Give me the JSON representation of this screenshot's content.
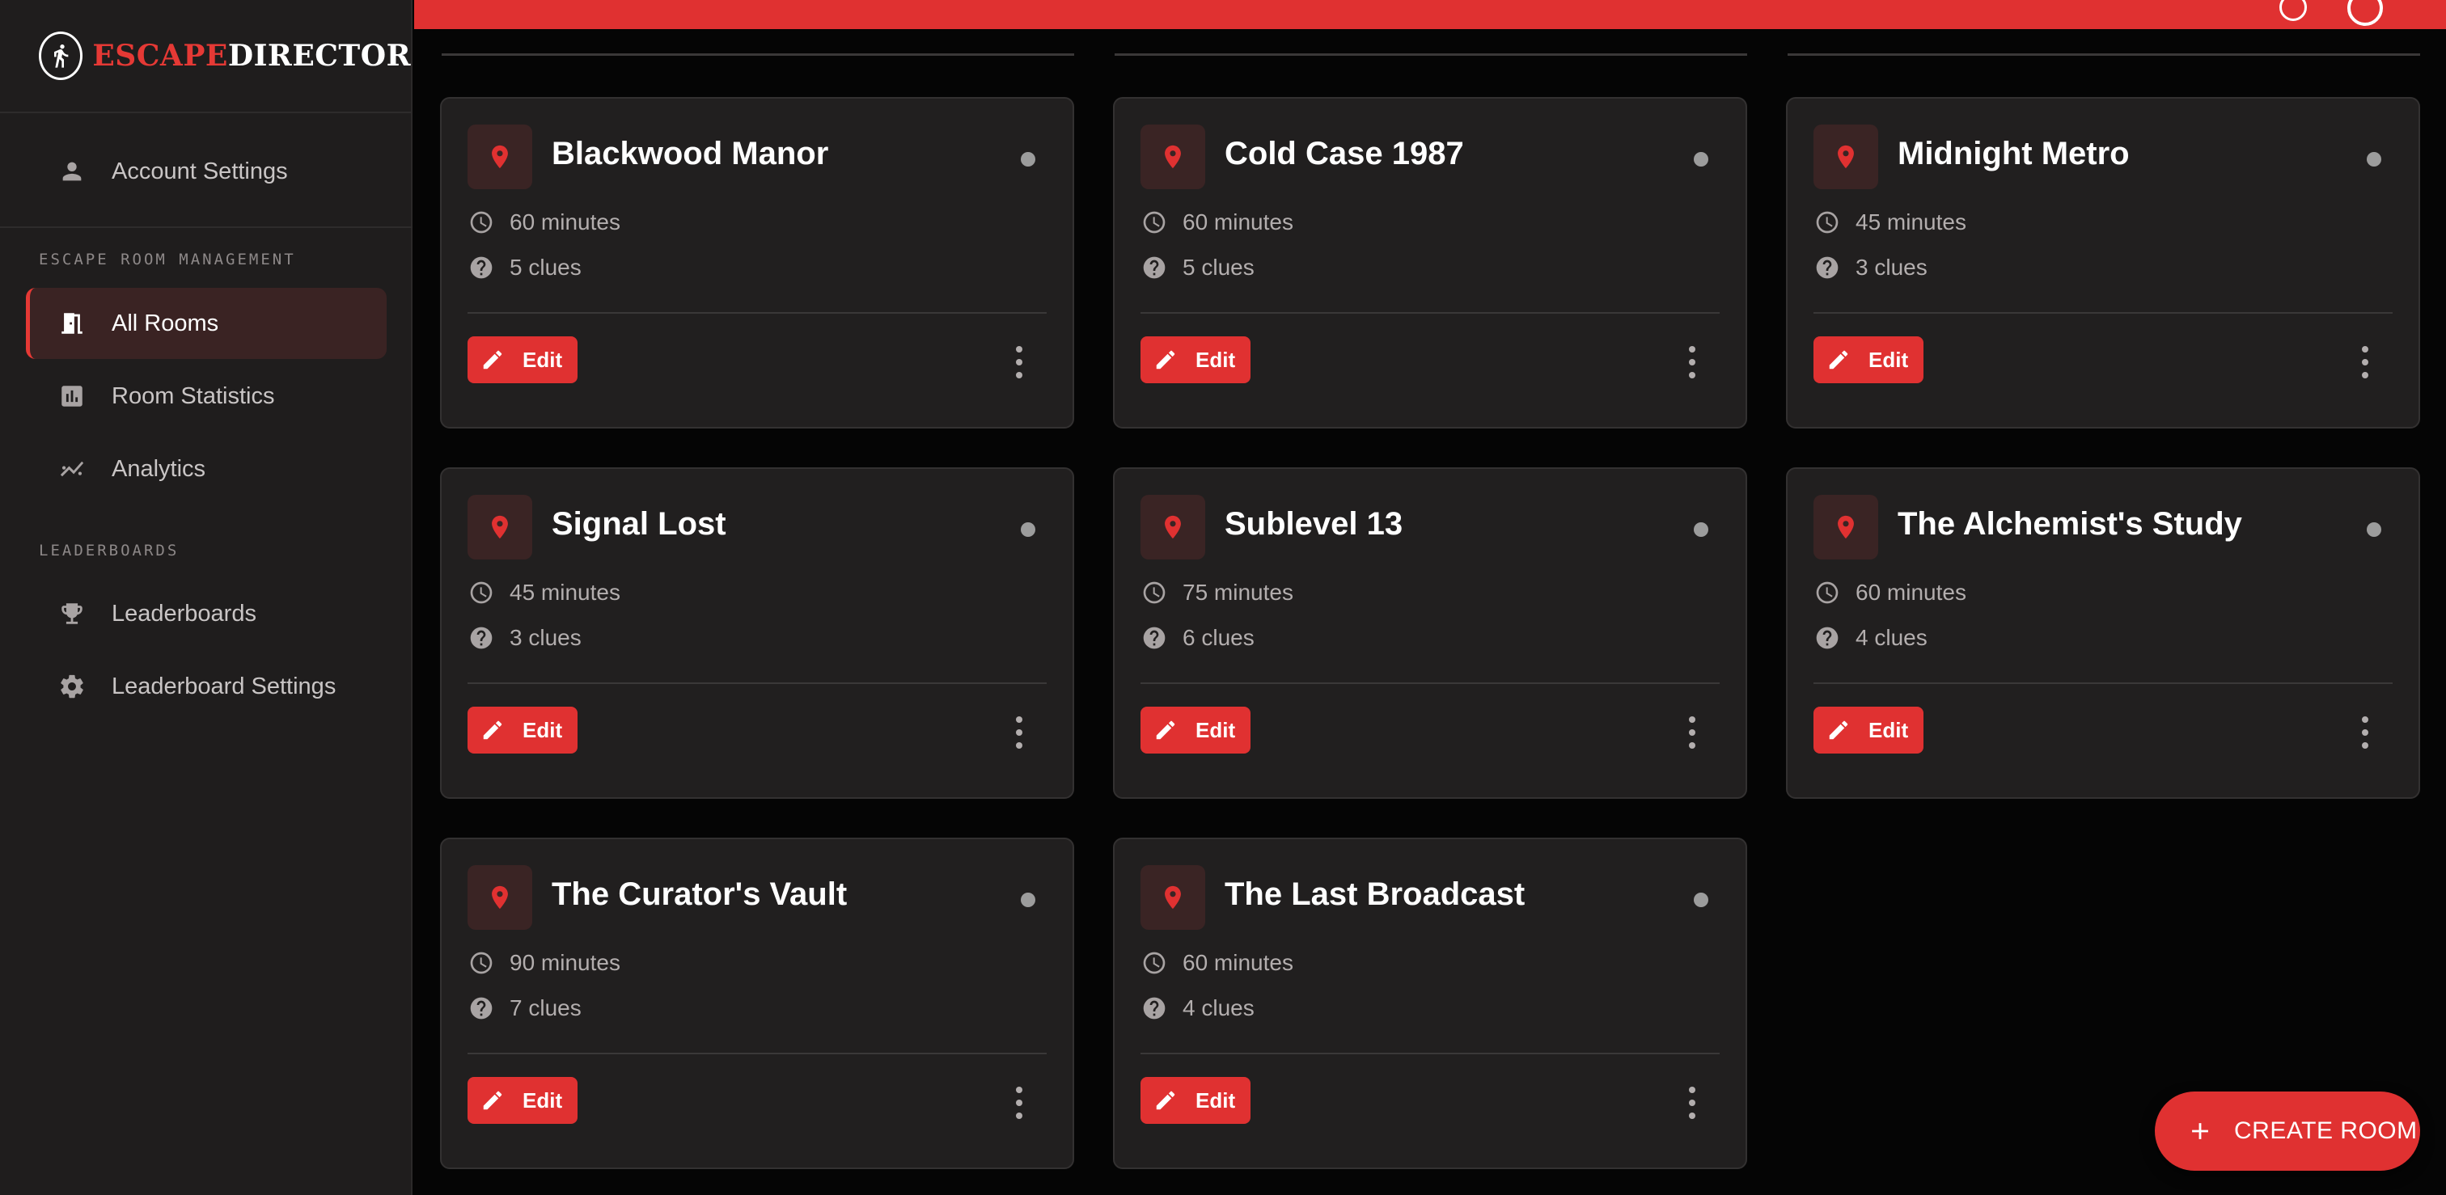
{
  "brand": {
    "part1": "ESCAPE",
    "part2": "DIRECTOR"
  },
  "sidebar": {
    "account_settings": "Account Settings",
    "section_management": "ESCAPE ROOM MANAGEMENT",
    "all_rooms": "All Rooms",
    "room_statistics": "Room Statistics",
    "analytics": "Analytics",
    "section_leaderboards": "LEADERBOARDS",
    "leaderboards": "Leaderboards",
    "leaderboard_settings": "Leaderboard Settings"
  },
  "rooms": [
    {
      "name": "Blackwood Manor",
      "duration": "60 minutes",
      "clues": "5 clues",
      "edit": "Edit"
    },
    {
      "name": "Cold Case 1987",
      "duration": "60 minutes",
      "clues": "5 clues",
      "edit": "Edit"
    },
    {
      "name": "Midnight Metro",
      "duration": "45 minutes",
      "clues": "3 clues",
      "edit": "Edit"
    },
    {
      "name": "Signal Lost",
      "duration": "45 minutes",
      "clues": "3 clues",
      "edit": "Edit"
    },
    {
      "name": "Sublevel 13",
      "duration": "75 minutes",
      "clues": "6 clues",
      "edit": "Edit"
    },
    {
      "name": "The Alchemist's Study",
      "duration": "60 minutes",
      "clues": "4 clues",
      "edit": "Edit"
    },
    {
      "name": "The Curator's Vault",
      "duration": "90 minutes",
      "clues": "7 clues",
      "edit": "Edit"
    },
    {
      "name": "The Last Broadcast",
      "duration": "60 minutes",
      "clues": "4 clues",
      "edit": "Edit"
    }
  ],
  "fab": {
    "label": "CREATE ROOM"
  },
  "colors": {
    "accent": "#e03131",
    "card_bg": "#211f1f",
    "sidebar_bg": "#1f1d1d",
    "page_bg": "#050505"
  }
}
